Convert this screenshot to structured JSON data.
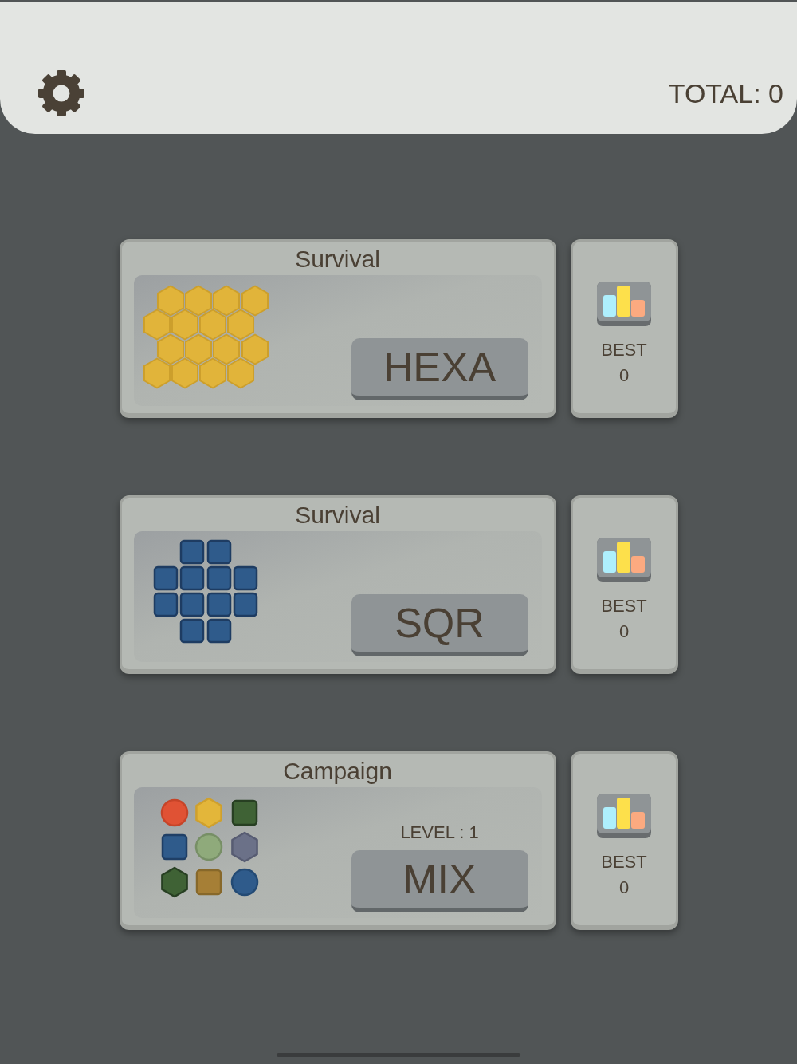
{
  "header": {
    "total": "TOTAL: 0"
  },
  "modes": [
    {
      "kind": "hexa",
      "title": "Survival",
      "button": "HEXA",
      "best_label": "BEST",
      "best_score": "0"
    },
    {
      "kind": "square",
      "title": "Survival",
      "button": "SQR",
      "best_label": "BEST",
      "best_score": "0"
    },
    {
      "kind": "mix",
      "title": "Campaign",
      "level_text": "LEVEL : 1",
      "button": "MIX",
      "best_label": "BEST",
      "best_score": "0"
    }
  ]
}
